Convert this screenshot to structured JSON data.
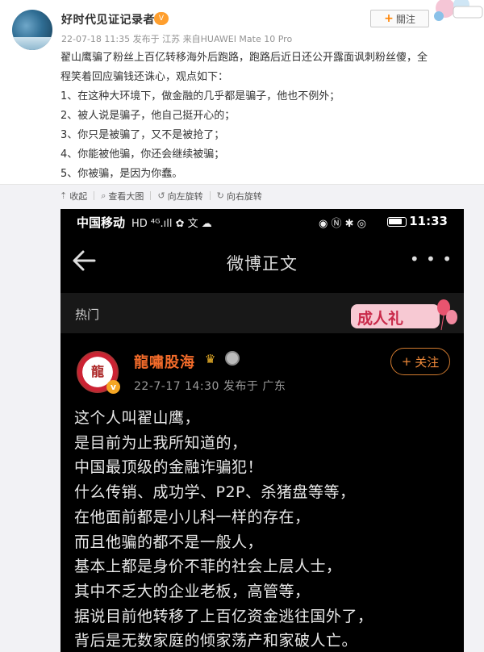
{
  "post": {
    "username": "好时代见证记录者",
    "vip_badge": "V",
    "meta": "22-07-18 11:35 发布于 江苏 来自HUAWEI Mate 10 Pro",
    "follow_label": "關注",
    "lines": [
      "翟山鹰骗了粉丝上百亿转移海外后跑路，跑路后近日还公开露面讽刺粉丝傻，全",
      "程笑着回应骗钱还诛心，观点如下：",
      "1、在这种大环境下，做金融的几乎都是骗子，他也不例外；",
      "2、被人说是骗子，他自己挺开心的；",
      "3、你只是被骗了，又不是被抢了；",
      "4、你能被他骗，你还会继续被骗；",
      "5、你被骗，是因为你蠢。"
    ]
  },
  "toolbar": {
    "collapse": "收起",
    "view_large": "查看大图",
    "rotate_left": "向左旋转",
    "rotate_right": "向右旋转"
  },
  "phone": {
    "carrier": "中国移动",
    "status_icons": "HD ⁴ᴳ.ıll  ✿  文  ☁",
    "right_icons": "◉ Ⓝ ✱ ◎",
    "time": "11:33",
    "nav_title": "微博正文",
    "more": "• • •",
    "hot_label": "热门",
    "ceremony_text": "成人礼",
    "author_name": "龍嘯股海",
    "author_seal": "龍",
    "v_badge": "v",
    "crown": "♛",
    "post_meta": "22-7-17 14:30  发布于 广东",
    "follow_label": "关注",
    "body": [
      "这个人叫翟山鹰，",
      "是目前为止我所知道的，",
      "中国最顶级的金融诈骗犯！",
      "什么传销、成功学、P2P、杀猪盘等等，",
      "在他面前都是小儿科一样的存在，",
      "而且他骗的都不是一般人，",
      "基本上都是身价不菲的社会上层人士，",
      "其中不乏大的企业老板，高管等，",
      "据说目前他转移了上百亿资金逃往国外了，",
      "背后是无数家庭的倾家荡产和家破人亡。"
    ]
  },
  "colors": {
    "accent_orange": "#ff8200",
    "author_orange": "#f26b2a",
    "phone_bg": "#000000"
  }
}
